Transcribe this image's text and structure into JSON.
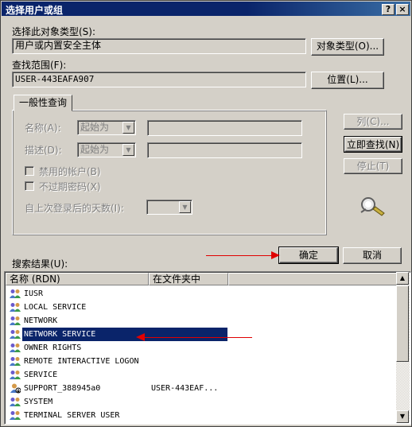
{
  "window": {
    "title": "选择用户或组",
    "help_button": "?",
    "close_button": "×"
  },
  "object_types": {
    "label": "选择此对象类型(S):",
    "value": "用户或内置安全主体",
    "button": "对象类型(O)..."
  },
  "location": {
    "label": "查找范围(F):",
    "value": "USER-443EAFA907",
    "button": "位置(L)..."
  },
  "query_tab": {
    "label": "一般性查询",
    "name_label": "名称(A):",
    "name_mode": "起始为",
    "desc_label": "描述(D):",
    "desc_mode": "起始为",
    "disabled_accounts": "禁用的帐户(B)",
    "non_expiring_pw": "不过期密码(X)",
    "days_since_logon": "自上次登录后的天数(I):"
  },
  "side_buttons": {
    "columns": "列(C)...",
    "find_now": "立即查找(N)",
    "stop": "停止(T)"
  },
  "ok_button": "确定",
  "cancel_button": "取消",
  "results": {
    "label": "搜索结果(U):",
    "col_name": "名称 (RDN)",
    "col_folder": "在文件夹中",
    "rows": [
      {
        "name": "IUSR",
        "folder": "",
        "icon": "group-icon"
      },
      {
        "name": "LOCAL SERVICE",
        "folder": "",
        "icon": "group-icon"
      },
      {
        "name": "NETWORK",
        "folder": "",
        "icon": "group-icon"
      },
      {
        "name": "NETWORK SERVICE",
        "folder": "",
        "icon": "group-icon",
        "selected": true
      },
      {
        "name": "OWNER RIGHTS",
        "folder": "",
        "icon": "group-icon"
      },
      {
        "name": "REMOTE INTERACTIVE LOGON",
        "folder": "",
        "icon": "group-icon"
      },
      {
        "name": "SERVICE",
        "folder": "",
        "icon": "group-icon"
      },
      {
        "name": "SUPPORT_388945a0",
        "folder": "USER-443EAF...",
        "icon": "disabled-user-icon"
      },
      {
        "name": "SYSTEM",
        "folder": "",
        "icon": "group-icon"
      },
      {
        "name": "TERMINAL SERVER USER",
        "folder": "",
        "icon": "group-icon"
      }
    ]
  },
  "colors": {
    "title_bar": "#0a246a",
    "selection": "#0a246a",
    "annotation_arrow": "#e00000"
  }
}
